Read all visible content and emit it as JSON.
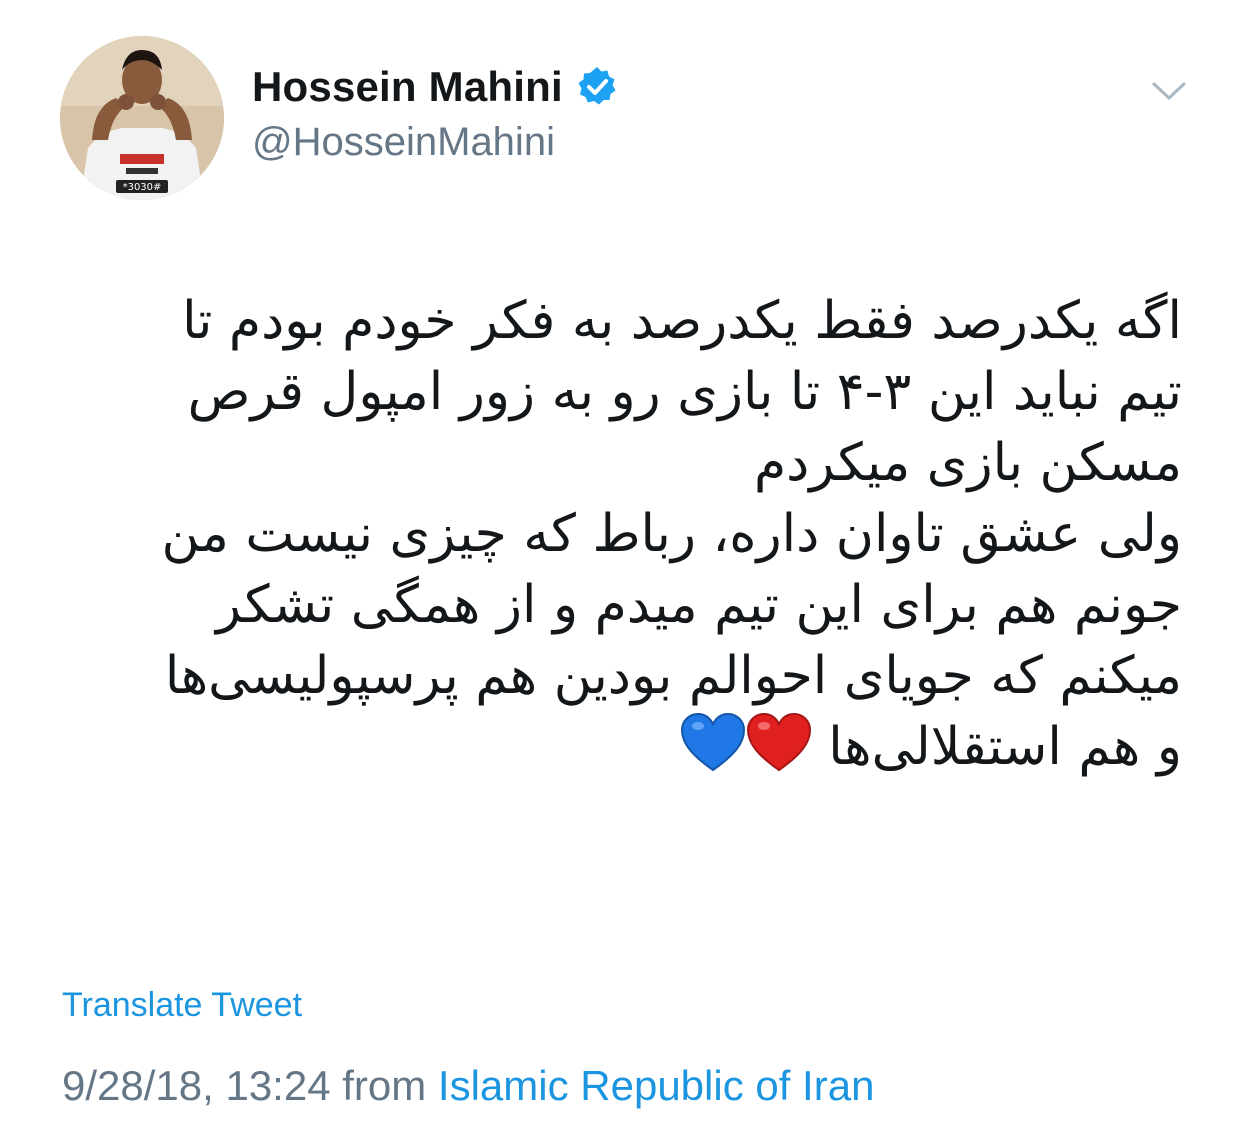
{
  "tweet": {
    "author": {
      "display_name": "Hossein Mahini",
      "handle": "@HosseinMahini",
      "verified": true,
      "avatar_icon": "profile-photo",
      "jersey_text": "*3030#"
    },
    "menu_icon": "chevron-down-icon",
    "text_lines": [
      "اگه یکدرصد فقط یکدرصد به فکر خودم بودم تا",
      "تیم نباید این ۳-۴ تا بازی رو به زور امپول قرص",
      "مسکن بازی میکردم",
      "ولی عشق تاوان داره، رباط که چیزی نیست من",
      "جونم هم برای این تیم میدم و از همگی تشکر",
      "میکنم که جویای احوالم بودین هم پرسپولیسی‌ها",
      "و هم استقلالی‌ها"
    ],
    "emojis": [
      "red-heart",
      "blue-heart"
    ],
    "translate_label": "Translate Tweet",
    "timestamp": "9/28/18, 13:24",
    "from_label": "from",
    "location": "Islamic Republic of Iran"
  },
  "colors": {
    "link": "#1b95e0",
    "secondary_text": "#657786",
    "primary_text": "#14171a",
    "verified_badge": "#1da1f2"
  }
}
